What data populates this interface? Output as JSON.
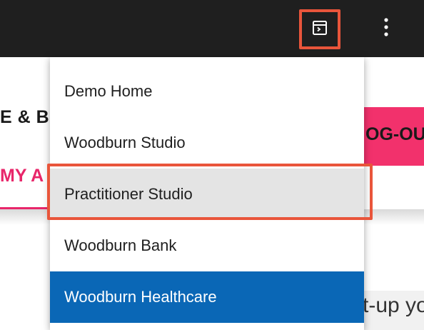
{
  "background": {
    "title_partial": "E & B",
    "tab_partial": "MY A",
    "logout_partial": "OG-OU",
    "bottom_partial": "t-up yo"
  },
  "toolbar": {
    "studio_icon": "terminal-window-icon",
    "more_icon": "vertical-dots-icon"
  },
  "menu": {
    "items": [
      {
        "label": "Demo Home"
      },
      {
        "label": "Woodburn Studio"
      },
      {
        "label": "Practitioner Studio"
      },
      {
        "label": "Woodburn Bank"
      },
      {
        "label": "Woodburn Healthcare"
      }
    ]
  },
  "colors": {
    "topbar": "#1f1f1f",
    "highlight_border": "#e9553b",
    "selected_bg": "#0a67b6",
    "accent_pink": "#e8266a"
  }
}
